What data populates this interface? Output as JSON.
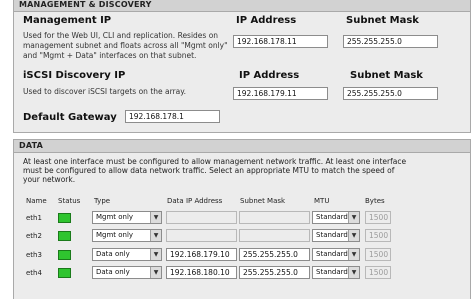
{
  "management": {
    "header": "MANAGEMENT & DISCOVERY",
    "mgmt_ip": {
      "title": "Management IP",
      "desc": [
        "Used for the Web UI, CLI and replication. Resides on",
        "management subnet and floats across all \"Mgmt only\"",
        "and \"Mgmt + Data\" interfaces on that subnet."
      ],
      "ip_label": "IP Address",
      "mask_label": "Subnet Mask",
      "ip_value": "192.168.178.11",
      "mask_value": "255.255.255.0"
    },
    "iscsi": {
      "title": "iSCSI Discovery IP",
      "desc": "Used to discover iSCSI targets on the array.",
      "ip_label": "IP Address",
      "mask_label": "Subnet Mask",
      "ip_value": "192.168.179.11",
      "mask_value": "255.255.255.0"
    },
    "gateway": {
      "title": "Default Gateway",
      "value": "192.168.178.1"
    }
  },
  "data": {
    "header": "DATA",
    "note": [
      "At least one interface must be configured to allow management network traffic. At least one interface",
      "must be configured to allow data network traffic. Select an appropriate MTU to match the speed of",
      "your network."
    ],
    "columns": {
      "name": "Name",
      "status": "Status",
      "type": "Type",
      "data_ip": "Data IP Address",
      "mask": "Subnet Mask",
      "mtu": "MTU",
      "bytes": "Bytes"
    },
    "rows": [
      {
        "name": "eth1",
        "status": "up",
        "type": "Mgmt only",
        "ip": "",
        "mask": "",
        "mtu": "Standard",
        "bytes": "1500"
      },
      {
        "name": "eth2",
        "status": "up",
        "type": "Mgmt only",
        "ip": "",
        "mask": "",
        "mtu": "Standard",
        "bytes": "1500"
      },
      {
        "name": "eth3",
        "status": "up",
        "type": "Data only",
        "ip": "192.168.179.10",
        "mask": "255.255.255.0",
        "mtu": "Standard",
        "bytes": "1500"
      },
      {
        "name": "eth4",
        "status": "up",
        "type": "Data only",
        "ip": "192.168.180.10",
        "mask": "255.255.255.0",
        "mtu": "Standard",
        "bytes": "1500"
      }
    ]
  },
  "colors": {
    "status_up": "#2fc42f",
    "panel_bg": "#ececec",
    "header_bg": "#d2d2d2"
  }
}
